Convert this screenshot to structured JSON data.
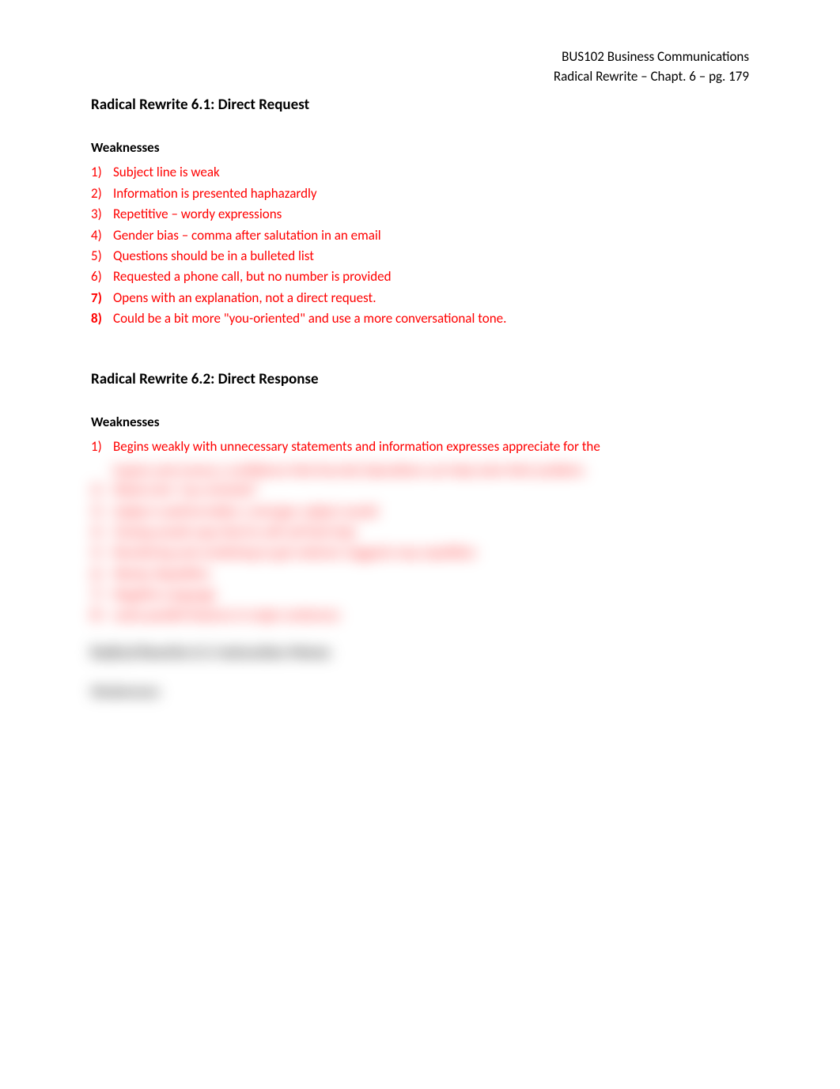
{
  "header": {
    "line1": "BUS102  Business Communications",
    "line2": "Radical Rewrite – Chapt. 6 – pg. 179"
  },
  "section1": {
    "title": "Radical Rewrite 6.1:  Direct Request",
    "heading": "Weaknesses",
    "items": [
      {
        "num": "1)",
        "text": "Subject line is weak",
        "bold": false
      },
      {
        "num": "2)",
        "text": "Information is presented haphazardly",
        "bold": false
      },
      {
        "num": "3)",
        "text": "Repetitive – wordy expressions",
        "bold": false
      },
      {
        "num": "4)",
        "text": "Gender bias – comma after salutation in an email",
        "bold": false
      },
      {
        "num": "5)",
        "text": "Questions should be in a bulleted list",
        "bold": false
      },
      {
        "num": "6)",
        "text": "Requested a phone call, but no number is provided",
        "bold": false
      },
      {
        "num": "7)",
        "text": "Opens with an explanation, not a direct request.",
        "bold": true
      },
      {
        "num": "8)",
        "text": "Could be a bit more \"you-oriented\" and use a more conversational tone.",
        "bold": true
      }
    ]
  },
  "section2": {
    "title": "Radical Rewrite 6.2:  Direct Response",
    "heading": "Weaknesses",
    "items": [
      {
        "num": "1)",
        "text": "Begins weakly with unnecessary statements and information expresses appreciate for the",
        "bold": false
      }
    ]
  },
  "blurred": {
    "cont": "inquiry and convey a confidence that Security Operations can help solve their problem.",
    "lines": [
      {
        "num": "2)",
        "text": "Weak echo \"you-oriented\""
      },
      {
        "num": "3)",
        "text": "Subject could be better a stronger subject would"
      },
      {
        "num": "4)",
        "text": "Closing would copy that he will call that help"
      },
      {
        "num": "5)",
        "text": "Reordering and combining to get ordered.  Suggests may repetition"
      },
      {
        "num": "6)",
        "text": "Wordy, Repetitive"
      },
      {
        "num": "7)",
        "text": "Negative Language"
      },
      {
        "num": "8)",
        "text": "Lacks parallel features in major sentences"
      }
    ],
    "heading": "Radical Rewrite 6.3:  Instruction Memo",
    "sub": "Weaknesses"
  }
}
